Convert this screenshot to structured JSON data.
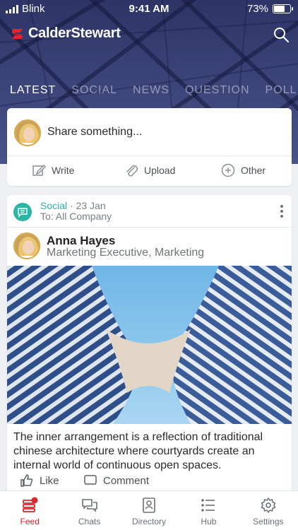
{
  "status_bar": {
    "carrier": "Blink",
    "time": "9:41 AM",
    "battery": "73%",
    "battery_level": 0.73
  },
  "header": {
    "brand": "CalderStewart"
  },
  "tabs": [
    {
      "label": "LATEST",
      "active": true
    },
    {
      "label": "SOCIAL",
      "active": false
    },
    {
      "label": "NEWS",
      "active": false
    },
    {
      "label": "QUESTION",
      "active": false
    },
    {
      "label": "POLL",
      "active": false
    }
  ],
  "composer": {
    "prompt": "Share something...",
    "actions": [
      {
        "label": "Write",
        "icon": "pencil-icon"
      },
      {
        "label": "Upload",
        "icon": "paperclip-icon"
      },
      {
        "label": "Other",
        "icon": "plus-circle-icon"
      }
    ]
  },
  "post": {
    "category": "Social",
    "date": "· 23 Jan",
    "audience": "To: All Company",
    "author": "Anna Hayes",
    "role": "Marketing Executive, Marketing",
    "body": "The inner arrangement is a reflection of traditional chinese architecture where courtyards create an internal world of continuous open spaces.",
    "like_label": "Like",
    "comment_label": "Comment"
  },
  "nav": [
    {
      "label": "Feed",
      "icon": "feed-icon",
      "active": true
    },
    {
      "label": "Chats",
      "icon": "chat-icon",
      "active": false
    },
    {
      "label": "Directory",
      "icon": "directory-icon",
      "active": false
    },
    {
      "label": "Hub",
      "icon": "hub-icon",
      "active": false
    },
    {
      "label": "Settings",
      "icon": "gear-icon",
      "active": false
    }
  ],
  "colors": {
    "accent": "#d8262c",
    "social": "#2bb5a4",
    "header": "#333a6e"
  }
}
